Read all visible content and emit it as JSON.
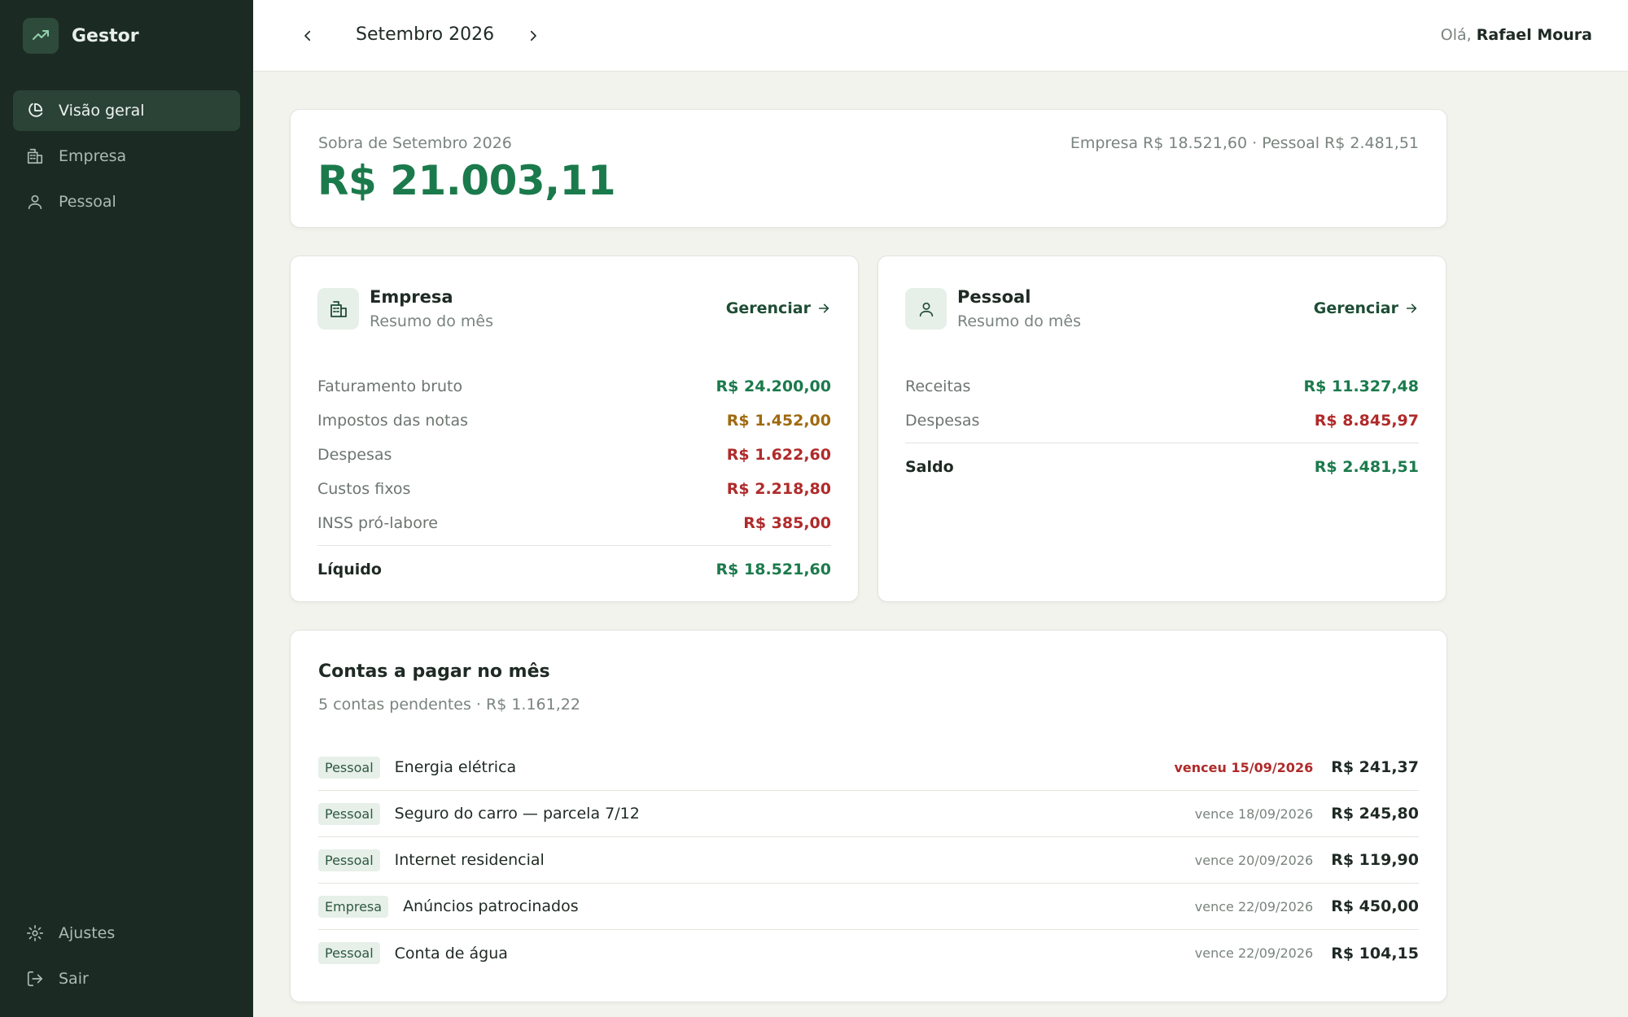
{
  "app": {
    "name": "Gestor"
  },
  "sidebar": {
    "items": [
      {
        "label": "Visão geral",
        "icon": "pie-chart-icon",
        "active": true
      },
      {
        "label": "Empresa",
        "icon": "building-icon",
        "active": false
      },
      {
        "label": "Pessoal",
        "icon": "user-icon",
        "active": false
      }
    ],
    "bottom": [
      {
        "label": "Ajustes",
        "icon": "gear-icon"
      },
      {
        "label": "Sair",
        "icon": "logout-icon"
      }
    ]
  },
  "header": {
    "month": "Setembro 2026",
    "greeting_prefix": "Olá,",
    "user_name": "Rafael Moura"
  },
  "summary": {
    "label": "Sobra de Setembro 2026",
    "total": "R$ 21.003,11",
    "split": "Empresa R$ 18.521,60 · Pessoal R$ 2.481,51"
  },
  "empresa": {
    "title": "Empresa",
    "subtitle": "Resumo do mês",
    "manage_label": "Gerenciar",
    "rows": [
      {
        "label": "Faturamento bruto",
        "value": "R$ 24.200,00"
      },
      {
        "label": "Impostos das notas",
        "value": "R$ 1.452,00"
      },
      {
        "label": "Despesas",
        "value": "R$ 1.622,60"
      },
      {
        "label": "Custos fixos",
        "value": "R$ 2.218,80"
      },
      {
        "label": "INSS pró-labore",
        "value": "R$ 385,00"
      }
    ],
    "total": {
      "label": "Líquido",
      "value": "R$ 18.521,60"
    }
  },
  "pessoal": {
    "title": "Pessoal",
    "subtitle": "Resumo do mês",
    "manage_label": "Gerenciar",
    "rows": [
      {
        "label": "Receitas",
        "value": "R$ 11.327,48"
      },
      {
        "label": "Despesas",
        "value": "R$ 8.845,97"
      }
    ],
    "total": {
      "label": "Saldo",
      "value": "R$ 2.481,51"
    }
  },
  "bills": {
    "title": "Contas a pagar no mês",
    "subtitle": "5 contas pendentes · R$ 1.161,22",
    "items": [
      {
        "tag": "Pessoal",
        "name": "Energia elétrica",
        "due": "venceu 15/09/2026",
        "amount": "R$ 241,37"
      },
      {
        "tag": "Pessoal",
        "name": "Seguro do carro — parcela 7/12",
        "due": "vence 18/09/2026",
        "amount": "R$ 245,80"
      },
      {
        "tag": "Pessoal",
        "name": "Internet residencial",
        "due": "vence 20/09/2026",
        "amount": "R$ 119,90"
      },
      {
        "tag": "Empresa",
        "name": "Anúncios patrocinados",
        "due": "vence 22/09/2026",
        "amount": "R$ 450,00"
      },
      {
        "tag": "Pessoal",
        "name": "Conta de água",
        "due": "vence 22/09/2026",
        "amount": "R$ 104,15"
      }
    ]
  },
  "colors": {
    "sidebar_bg": "#1b2b23",
    "positive": "#1b7a4c",
    "warning": "#a06a10",
    "negative": "#b02a2a"
  }
}
